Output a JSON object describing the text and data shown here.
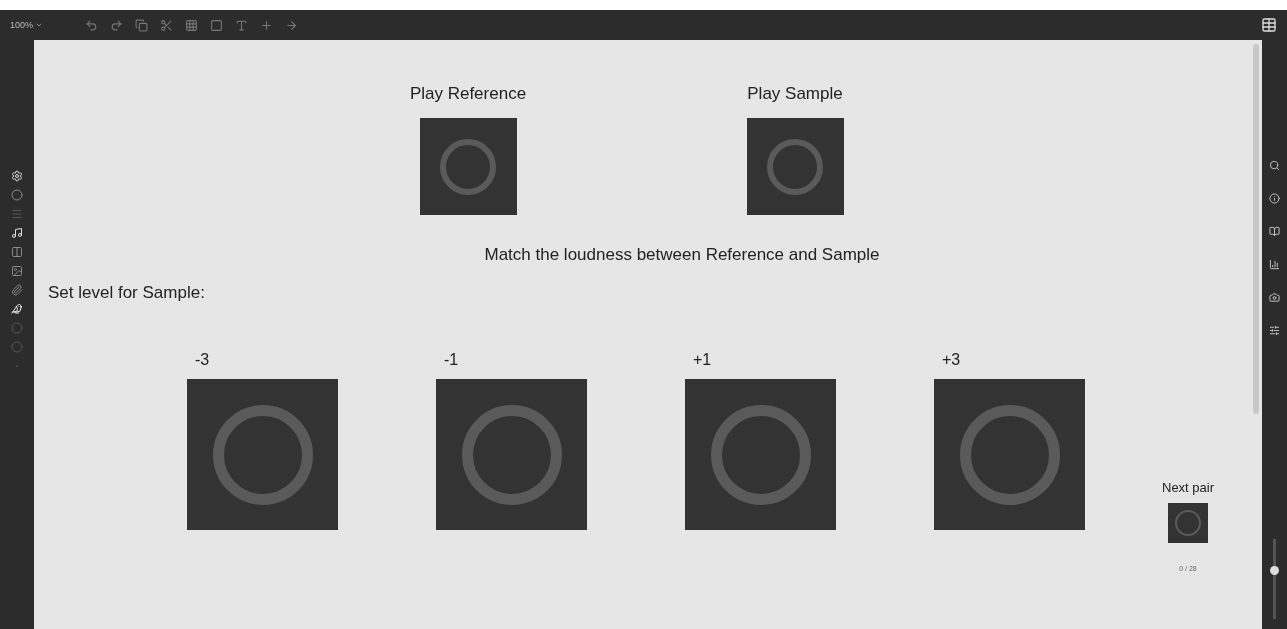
{
  "toolbar": {
    "zoom": "100%"
  },
  "players": [
    {
      "label": "Play Reference"
    },
    {
      "label": "Play Sample"
    }
  ],
  "instruction": "Match the loudness between Reference and Sample",
  "level_prompt": "Set level for Sample:",
  "levels": [
    {
      "label": "-3"
    },
    {
      "label": "-1"
    },
    {
      "label": "+1"
    },
    {
      "label": "+3"
    }
  ],
  "next": {
    "label": "Next pair",
    "progress": "0 / 28"
  },
  "volume": {
    "level": 0.6
  }
}
